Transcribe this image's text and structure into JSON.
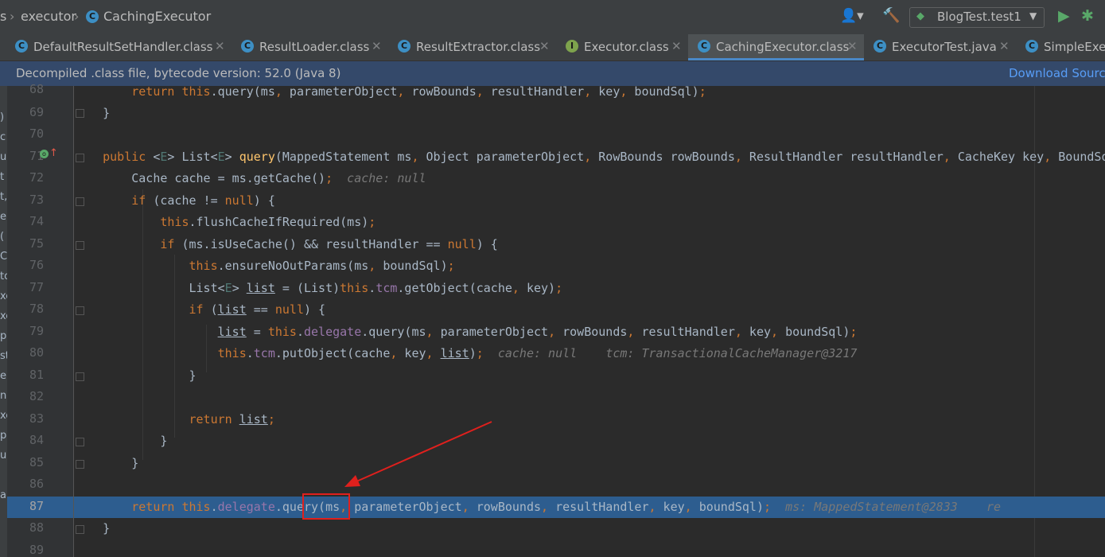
{
  "breadcrumb": {
    "prev": "s",
    "package": "executor",
    "class": "CachingExecutor"
  },
  "toolbar": {
    "run_config": "BlogTest.test1"
  },
  "tabs": [
    {
      "label": "DefaultResultSetHandler.class",
      "icon": "C"
    },
    {
      "label": "ResultLoader.class",
      "icon": "C"
    },
    {
      "label": "ResultExtractor.class",
      "icon": "C"
    },
    {
      "label": "Executor.class",
      "icon": "I"
    },
    {
      "label": "CachingExecutor.class",
      "icon": "C"
    },
    {
      "label": "ExecutorTest.java",
      "icon": "C"
    },
    {
      "label": "SimpleExec",
      "icon": "C"
    }
  ],
  "banner": {
    "text": "Decompiled .class file, bytecode version: 52.0 (Java 8)",
    "link": "Download Sourc"
  },
  "line_numbers": [
    "68",
    "69",
    "70",
    "71",
    "72",
    "73",
    "74",
    "75",
    "76",
    "77",
    "78",
    "79",
    "80",
    "81",
    "82",
    "83",
    "84",
    "85",
    "86",
    "87",
    "88",
    "89"
  ],
  "inline_values": {
    "l72": "cache: null",
    "l80a": "cache: null",
    "l80b": "tcm: TransactionalCacheManager@3217",
    "l87a": "ms: MappedStatement@2833",
    "l87b": "re"
  },
  "colors": {
    "keyword": "#cc7832",
    "method": "#ffc66d",
    "field": "#9876aa",
    "highlight": "#2d5d8f",
    "annotation_box": "#e0201d"
  },
  "left_strip_chars": [
    ")",
    "c",
    "u",
    "t",
    "t,",
    "er",
    "(",
    "C",
    "to",
    "xe",
    "xe",
    "p",
    "st",
    "er",
    "ne",
    "xe",
    "p",
    "u",
    "a"
  ]
}
